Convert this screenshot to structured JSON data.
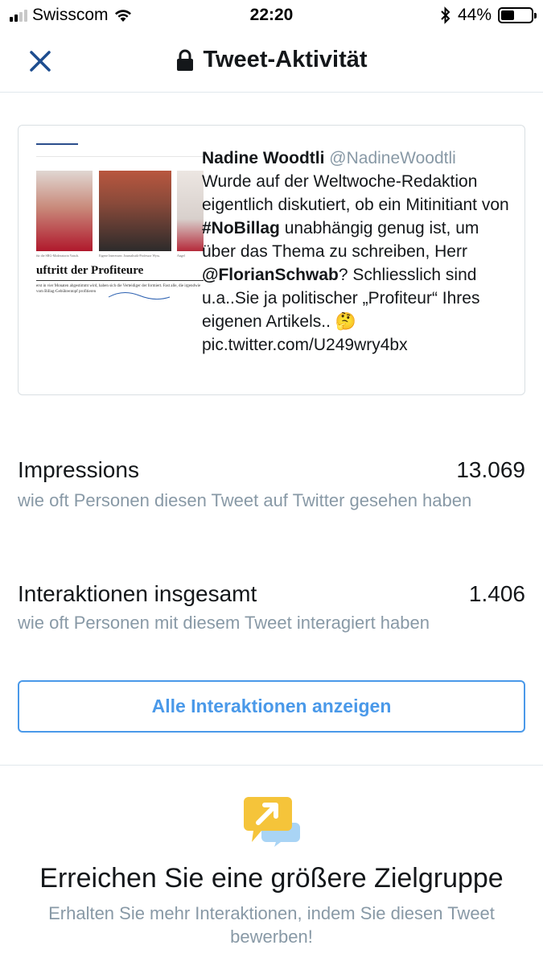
{
  "status_bar": {
    "carrier": "Swisscom",
    "time": "22:20",
    "battery": "44%",
    "battery_level": 0.44,
    "signal_bars_on": 2,
    "signal_bars_total": 4
  },
  "nav": {
    "title": "Tweet-Aktivität"
  },
  "tweet": {
    "name": "Nadine Woodtli",
    "handle": "@NadineWoodtli",
    "text_1": "Wurde auf der Weltwoche-Redaktion eigentlich diskutiert, ob ein Mitinitiant von ",
    "hashtag": "#NoBillag",
    "text_2": " unabhängig genug ist, um über das Thema zu schreiben, Herr ",
    "mention": "@FlorianSchwab",
    "text_3": "? Schliesslich sind u.a..Sie ja politischer „Profiteur“ Ihres eigenen Artikels.. 🤔 pic.twitter.com/U249wry4bx",
    "thumbnail": {
      "caption_1": "für die SRG-Moderatorin Vatsch.",
      "caption_2": "Eigene Interessen: Journalistik-Professor Wyss.",
      "caption_3": "Angel",
      "headline": "uftritt der Profiteure",
      "body": "erst in vier Monaten abgestimmt wird, haben sich die Verteidiger der formiert. Fast alle, die irgendwie vom Billag-Gebührentopf profitieren"
    }
  },
  "stats": [
    {
      "label": "Impressions",
      "value": "13.069",
      "description": "wie oft Personen diesen Tweet auf Twitter gesehen haben"
    },
    {
      "label": "Interaktionen insgesamt",
      "value": "1.406",
      "description": "wie oft Personen mit diesem Tweet interagiert haben"
    }
  ],
  "button": {
    "label": "Alle Interaktionen anzeigen"
  },
  "promo": {
    "title": "Erreichen Sie eine größere Zielgruppe",
    "description": "Erhalten Sie mehr Interaktionen, indem Sie diesen Tweet bewerben!",
    "icon": "promote-icon"
  },
  "colors": {
    "accent": "#4a99e9",
    "nav_close": "#1d4d8f",
    "secondary_text": "#8899a6",
    "promo_yellow": "#f5c43a",
    "promo_blue": "#a9d4f5"
  }
}
